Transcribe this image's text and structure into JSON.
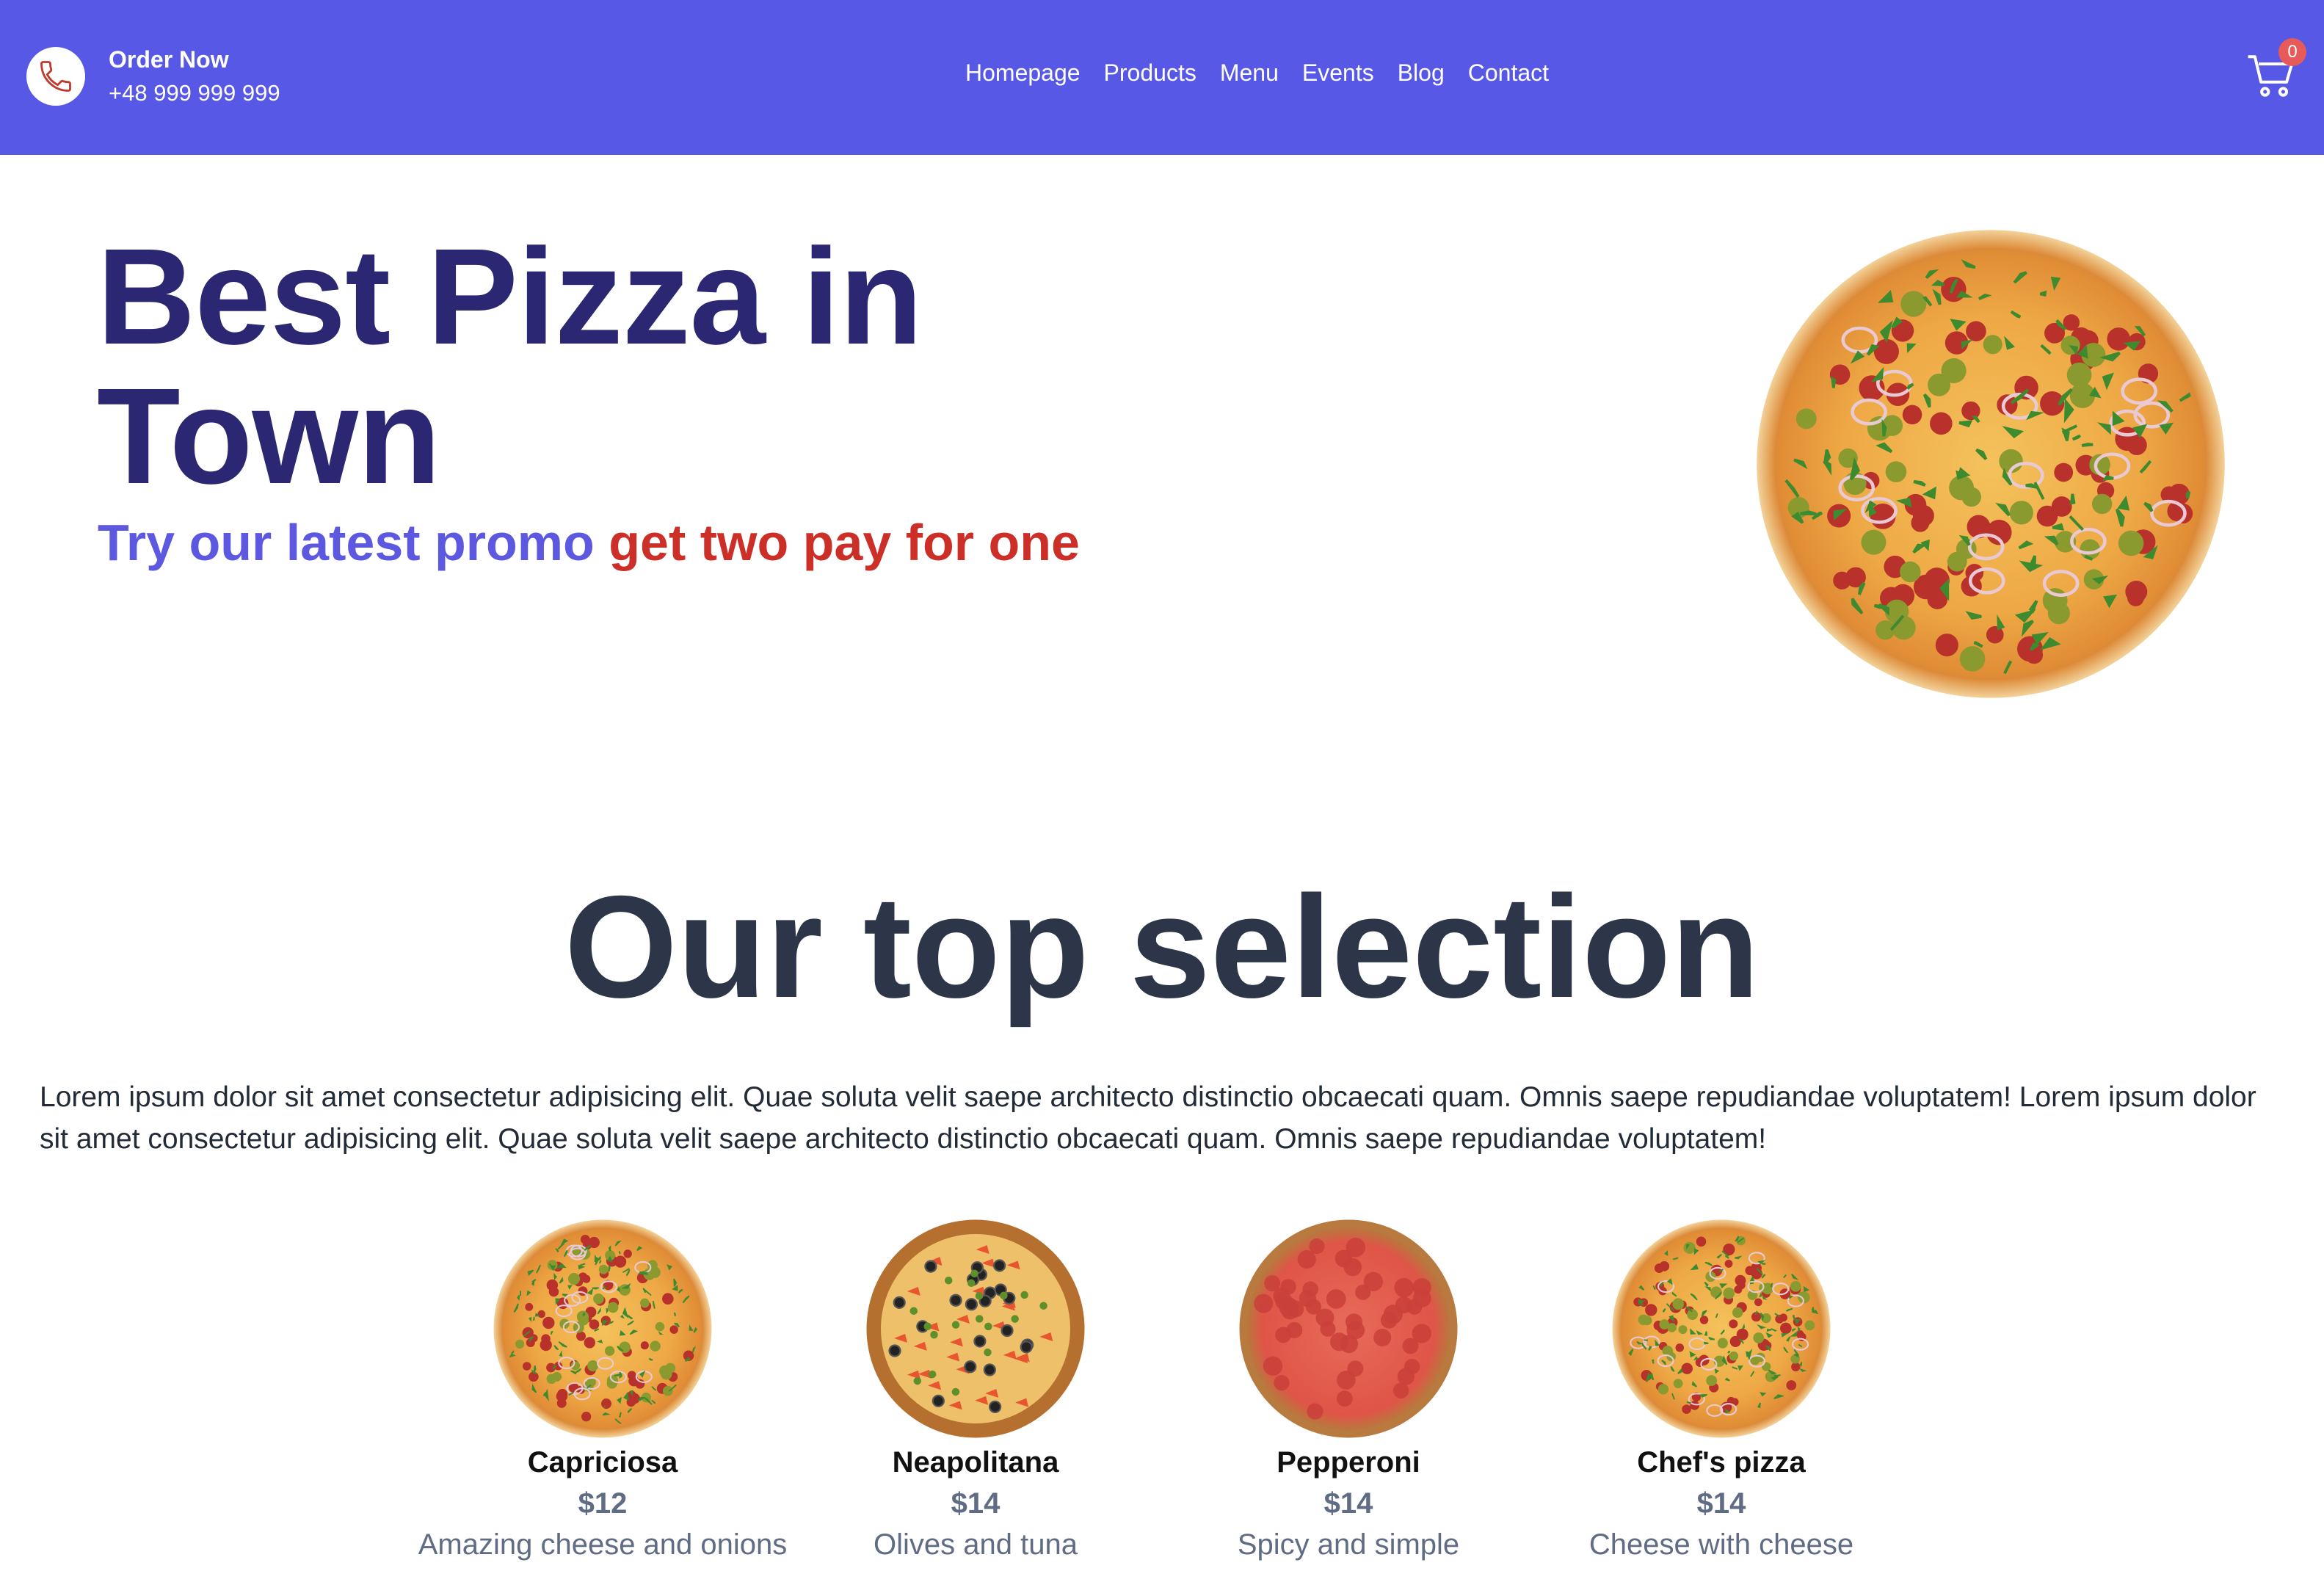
{
  "header": {
    "order_title": "Order Now",
    "order_phone": "+48 999 999 999",
    "icons": {
      "phone": "phone-icon",
      "cart": "shopping-cart-icon"
    },
    "nav": [
      {
        "label": "Homepage"
      },
      {
        "label": "Products"
      },
      {
        "label": "Menu"
      },
      {
        "label": "Events"
      },
      {
        "label": "Blog"
      },
      {
        "label": "Contact"
      }
    ],
    "cart_count": "0"
  },
  "hero": {
    "title": "Best Pizza in Town",
    "promo_part1": "Try our latest promo",
    "promo_part2": "get two pay for one"
  },
  "selection": {
    "title": "Our top selection",
    "description": "Lorem ipsum dolor sit amet consectetur adipisicing elit. Quae soluta velit saepe architecto distinctio obcaecati quam. Omnis saepe repudiandae voluptatem! Lorem ipsum dolor sit amet consectetur adipisicing elit. Quae soluta velit saepe architecto distinctio obcaecati quam. Omnis saepe repudiandae voluptatem!",
    "products": [
      {
        "name": "Capriciosa",
        "price": "$12",
        "description": "Amazing cheese and onions"
      },
      {
        "name": "Neapolitana",
        "price": "$14",
        "description": "Olives and tuna"
      },
      {
        "name": "Pepperoni",
        "price": "$14",
        "description": "Spicy and simple"
      },
      {
        "name": "Chef's pizza",
        "price": "$14",
        "description": "Cheese with cheese"
      }
    ]
  },
  "colors": {
    "navbar": "#5858e6",
    "hero_title": "#2c2773",
    "promo_blue": "#5c58e0",
    "promo_red": "#cc2e28",
    "section_title": "#2d3648",
    "price_text": "#5f6c84",
    "cart_badge": "#e65a5a"
  }
}
